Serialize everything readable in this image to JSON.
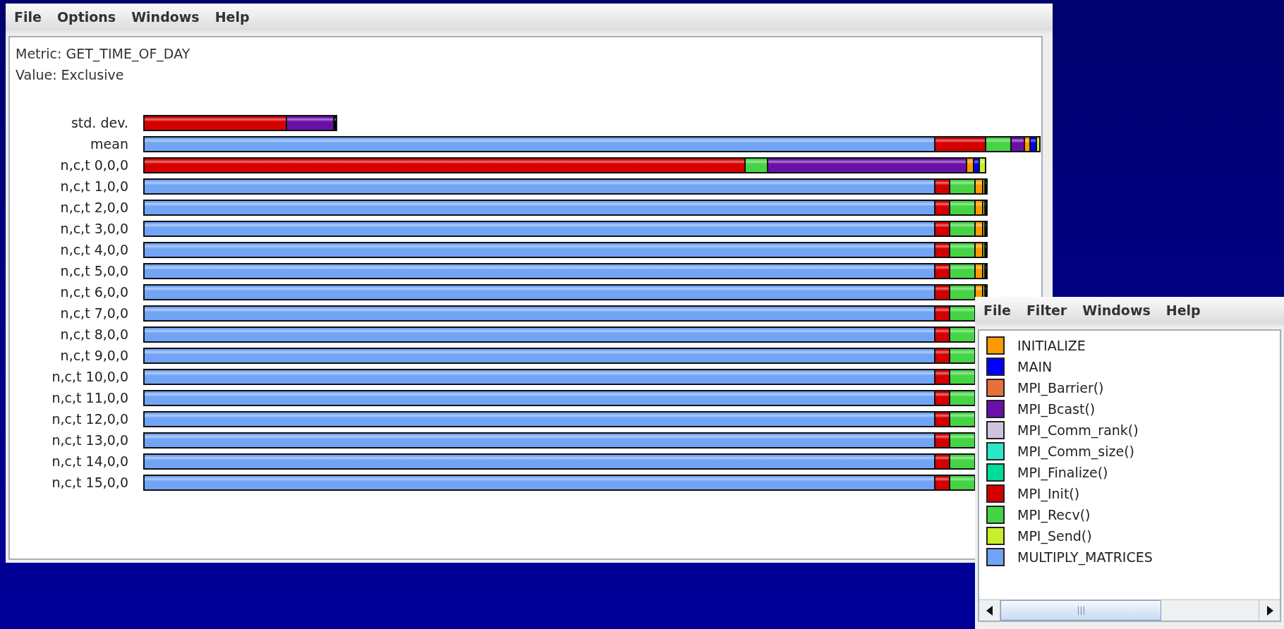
{
  "main_window": {
    "menu": [
      "File",
      "Options",
      "Windows",
      "Help"
    ],
    "metric": "Metric: GET_TIME_OF_DAY",
    "value": "Value: Exclusive",
    "rows": [
      {
        "label": "std. dev."
      },
      {
        "label": "mean"
      },
      {
        "label": "n,c,t 0,0,0"
      },
      {
        "label": "n,c,t 1,0,0"
      },
      {
        "label": "n,c,t 2,0,0"
      },
      {
        "label": "n,c,t 3,0,0"
      },
      {
        "label": "n,c,t 4,0,0"
      },
      {
        "label": "n,c,t 5,0,0"
      },
      {
        "label": "n,c,t 6,0,0"
      },
      {
        "label": "n,c,t 7,0,0"
      },
      {
        "label": "n,c,t 8,0,0"
      },
      {
        "label": "n,c,t 9,0,0"
      },
      {
        "label": "n,c,t 10,0,0"
      },
      {
        "label": "n,c,t 11,0,0"
      },
      {
        "label": "n,c,t 12,0,0"
      },
      {
        "label": "n,c,t 13,0,0"
      },
      {
        "label": "n,c,t 14,0,0"
      },
      {
        "label": "n,c,t 15,0,0"
      }
    ]
  },
  "legend_window": {
    "menu": [
      "File",
      "Filter",
      "Windows",
      "Help"
    ],
    "items": [
      {
        "name": "INITIALIZE",
        "color": "#ff9900"
      },
      {
        "name": "MAIN",
        "color": "#0000ff"
      },
      {
        "name": "MPI_Barrier()",
        "color": "#e8703a"
      },
      {
        "name": "MPI_Bcast()",
        "color": "#6a10a8"
      },
      {
        "name": "MPI_Comm_rank()",
        "color": "#cdc3dc"
      },
      {
        "name": "MPI_Comm_size()",
        "color": "#2de8c8"
      },
      {
        "name": "MPI_Finalize()",
        "color": "#00dc9a"
      },
      {
        "name": "MPI_Init()",
        "color": "#d40000"
      },
      {
        "name": "MPI_Recv()",
        "color": "#44d444"
      },
      {
        "name": "MPI_Send()",
        "color": "#c8f02a"
      },
      {
        "name": "MULTIPLY_MATRICES",
        "color": "#72a4f5"
      }
    ]
  }
}
